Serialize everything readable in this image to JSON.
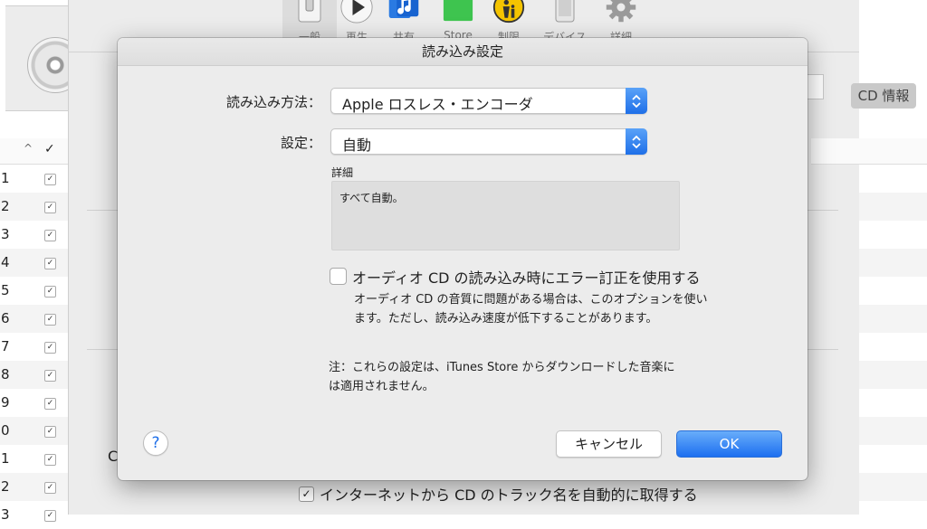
{
  "background": {
    "toolbar": [
      {
        "label": "一般",
        "icon": "switch-icon",
        "selected": true
      },
      {
        "label": "再生",
        "icon": "play-icon",
        "selected": false
      },
      {
        "label": "共有",
        "icon": "music-note-icon",
        "selected": false
      },
      {
        "label": "Store",
        "icon": "store-bag-icon",
        "selected": false
      },
      {
        "label": "制限",
        "icon": "parental-icon",
        "selected": false
      },
      {
        "label": "デバイス",
        "icon": "phone-icon",
        "selected": false
      },
      {
        "label": "詳細",
        "icon": "gear-icon",
        "selected": false
      }
    ],
    "track_sort_icon": "^",
    "track_check_head": "✓",
    "track_numbers": [
      "1",
      "2",
      "3",
      "4",
      "5",
      "6",
      "7",
      "8",
      "9",
      "0",
      "1",
      "2",
      "3"
    ],
    "cd_info_button": "CD 情報",
    "partial_left_letter": "C",
    "import_option_check": "✓",
    "import_option_label": "インターネットから CD のトラック名を自動的に取得する"
  },
  "dialog": {
    "title": "読み込み設定",
    "import_method_label": "読み込み方法：",
    "import_method_value": "Apple ロスレス・エンコーダ",
    "setting_label": "設定：",
    "setting_value": "自動",
    "detail_label": "詳細",
    "detail_text": "すべて自動。",
    "error_correction_label": "オーディオ CD の読み込み時にエラー訂正を使用する",
    "error_correction_checked": false,
    "error_correction_desc_1": "オーディオ CD の音質に問題がある場合は、このオプションを使い",
    "error_correction_desc_2": "ます。ただし、読み込み速度が低下することがあります。",
    "note_1": "注：これらの設定は、iTunes Store からダウンロードした音楽に",
    "note_2": "は適用されません。",
    "help_button": "?",
    "cancel_button": "キャンセル",
    "ok_button": "OK",
    "accent_color": "#1e6fe8"
  }
}
